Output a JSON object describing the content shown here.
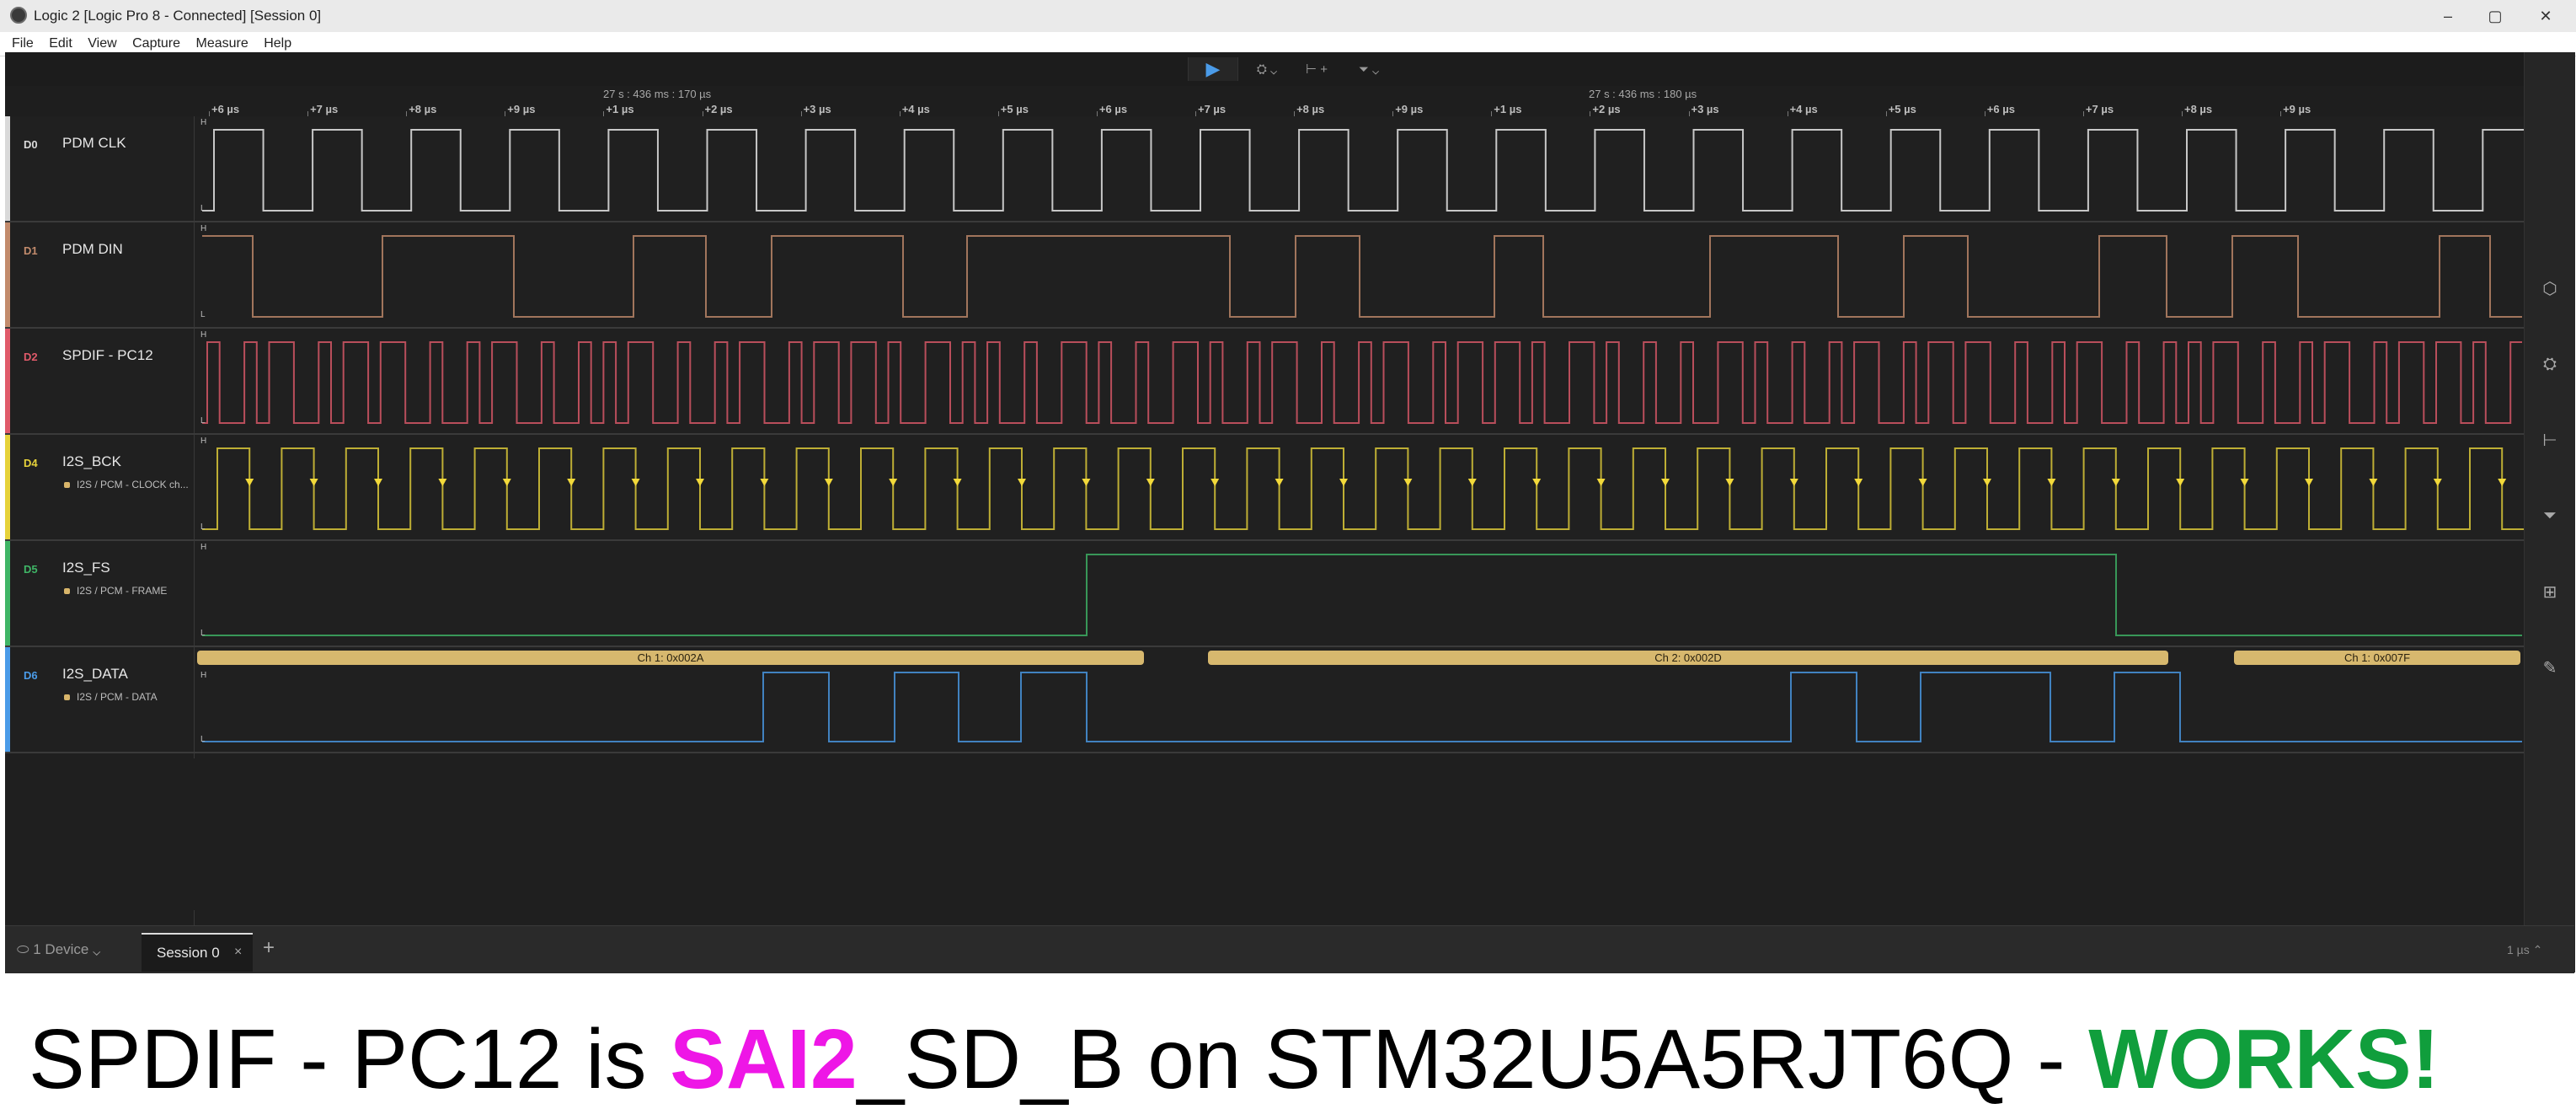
{
  "window": {
    "title": "Logic 2 [Logic Pro 8 - Connected] [Session 0]",
    "minimize": "–",
    "maximize": "▢",
    "close": "✕"
  },
  "menu": [
    "File",
    "Edit",
    "View",
    "Capture",
    "Measure",
    "Help"
  ],
  "toolbar": {
    "play": "▶",
    "trigger": "⛭ ⌄",
    "measure": "⊢ +",
    "marker": "⏷ ⌄"
  },
  "ruler": {
    "header_left": "27 s : 436 ms : 170 µs",
    "header_right": "27 s : 436 ms : 180 µs",
    "ticks": [
      "+6 µs",
      "+7 µs",
      "+8 µs",
      "+9 µs",
      "+1 µs",
      "+2 µs",
      "+3 µs",
      "+4 µs",
      "+5 µs",
      "+6 µs",
      "+7 µs",
      "+8 µs",
      "+9 µs",
      "+1 µs",
      "+2 µs",
      "+3 µs",
      "+4 µs",
      "+5 µs",
      "+6 µs",
      "+7 µs",
      "+8 µs",
      "+9 µs"
    ]
  },
  "channels": [
    {
      "id": "D0",
      "name": "PDM CLK",
      "color": "#d9d9d9",
      "sub": ""
    },
    {
      "id": "D1",
      "name": "PDM DIN",
      "color": "#c28b6c",
      "sub": ""
    },
    {
      "id": "D2",
      "name": "SPDIF - PC12",
      "color": "#e05a6a",
      "sub": ""
    },
    {
      "id": "D4",
      "name": "I2S_BCK",
      "color": "#e6d23a",
      "sub": "I2S / PCM - CLOCK ch..."
    },
    {
      "id": "D5",
      "name": "I2S_FS",
      "color": "#3fb566",
      "sub": "I2S / PCM - FRAME"
    },
    {
      "id": "D6",
      "name": "I2S_DATA",
      "color": "#4a9be8",
      "sub": "I2S / PCM - DATA"
    }
  ],
  "level_labels": {
    "high": "H",
    "low": "L"
  },
  "decoded": [
    "Ch 1: 0x002A",
    "Ch 2: 0x002D",
    "Ch 1: 0x007F"
  ],
  "bottom": {
    "device": "1 Device",
    "session_tab": "Session 0",
    "close": "×",
    "add": "+",
    "zoom": "1 µs ⌃"
  },
  "caption": {
    "part1": "SPDIF - PC12 is ",
    "part2": "SAI2",
    "part3": "_SD_B on STM32U5A5RJT6Q - ",
    "part4": "WORKS!"
  }
}
